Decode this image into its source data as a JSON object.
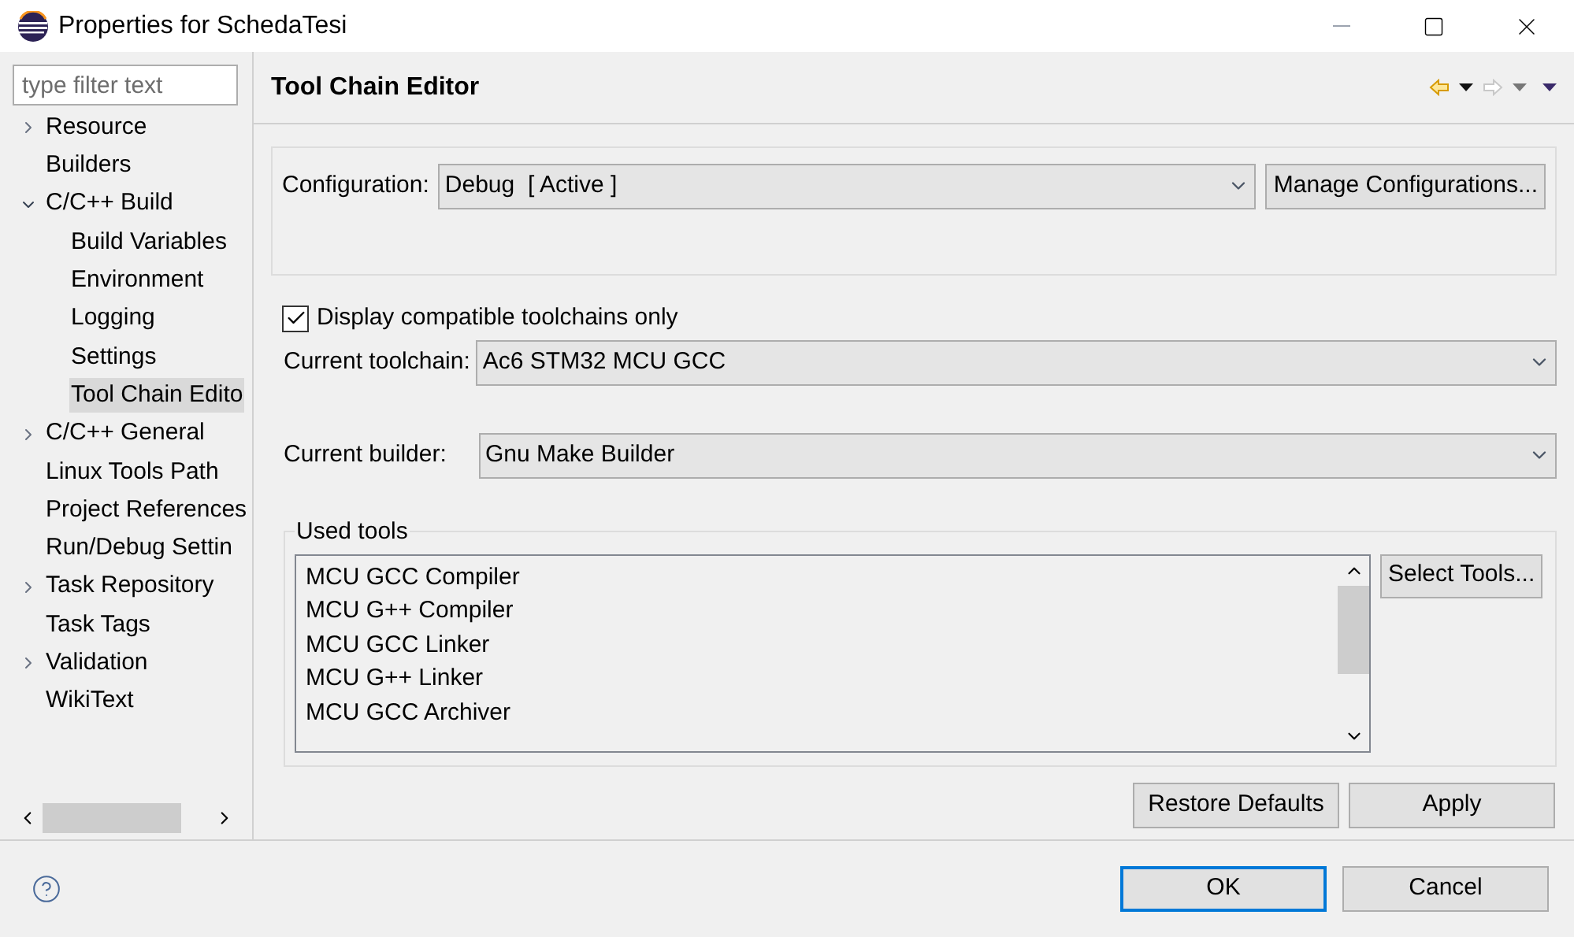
{
  "window": {
    "title": "Properties for SchedaTesi"
  },
  "sidebar": {
    "filter": {
      "placeholder": "type filter text"
    },
    "items": [
      {
        "label": "Resource",
        "expanded": false,
        "selected": false
      },
      {
        "label": "Builders",
        "selected": false
      },
      {
        "label": "C/C++ Build",
        "expanded": true,
        "selected": false,
        "children": [
          {
            "label": "Build Variables",
            "selected": false
          },
          {
            "label": "Environment",
            "selected": false
          },
          {
            "label": "Logging",
            "selected": false
          },
          {
            "label": "Settings",
            "selected": false
          },
          {
            "label": "Tool Chain Edito",
            "selected": true
          }
        ]
      },
      {
        "label": "C/C++ General",
        "expanded": false,
        "selected": false
      },
      {
        "label": "Linux Tools Path",
        "selected": false
      },
      {
        "label": "Project References",
        "selected": false
      },
      {
        "label": "Run/Debug Settin",
        "selected": false
      },
      {
        "label": "Task Repository",
        "expanded": false,
        "selected": false
      },
      {
        "label": "Task Tags",
        "selected": false
      },
      {
        "label": "Validation",
        "expanded": false,
        "selected": false
      },
      {
        "label": "WikiText",
        "selected": false
      }
    ]
  },
  "page": {
    "title": "Tool Chain Editor",
    "configuration": {
      "label": "Configuration:",
      "value": "Debug  [ Active ]",
      "button": "Manage Configurations..."
    },
    "compatible_only": {
      "label": "Display compatible toolchains only",
      "checked": true
    },
    "toolchain": {
      "label": "Current toolchain:",
      "value": "Ac6 STM32 MCU GCC"
    },
    "builder": {
      "label": "Current builder:",
      "value": "Gnu Make Builder"
    },
    "used_tools": {
      "label": "Used tools",
      "items": [
        "MCU GCC Compiler",
        "MCU G++ Compiler",
        "MCU GCC Linker",
        "MCU G++ Linker",
        "MCU GCC Archiver"
      ],
      "button": "Select Tools..."
    },
    "buttons": [
      "Restore Defaults",
      "Apply"
    ]
  },
  "footer": {
    "buttons": [
      {
        "label": "OK",
        "default": true
      },
      {
        "label": "Cancel",
        "default": false
      }
    ]
  }
}
